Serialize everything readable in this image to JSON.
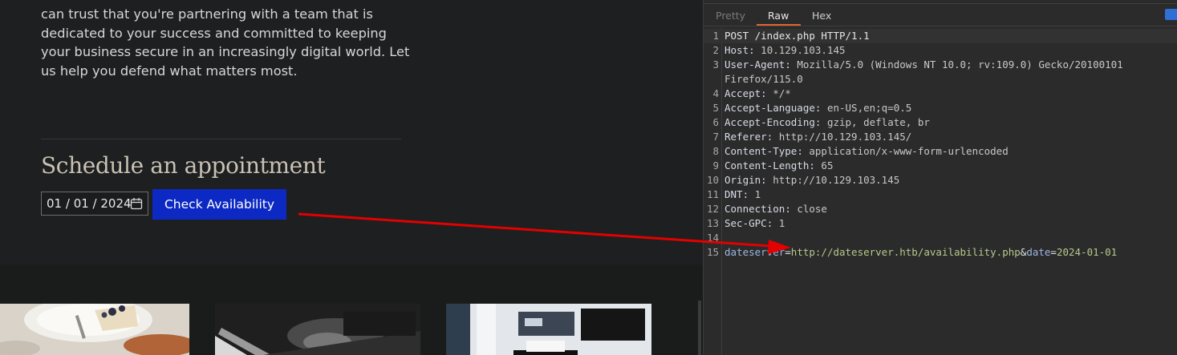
{
  "website": {
    "paragraph_lines": [
      "can trust that you're partnering with a team that is",
      "dedicated to your success and committed to keeping",
      "your business secure in an increasingly digital world. Let",
      "us help you defend what matters most."
    ],
    "schedule_title": "Schedule an appointment",
    "date": {
      "month": "01",
      "day": "01",
      "year": "2024"
    },
    "check_button": "Check Availability"
  },
  "burp": {
    "tabs": [
      "Pretty",
      "Raw",
      "Hex"
    ],
    "active_tab": "Raw",
    "request": {
      "request_line": "POST /index.php HTTP/1.1",
      "headers": [
        {
          "n": "Host",
          "v": "10.129.103.145"
        },
        {
          "n": "User-Agent",
          "v": "Mozilla/5.0 (Windows NT 10.0; rv:109.0) Gecko/20100101"
        },
        {
          "n": "",
          "v": "Firefox/115.0"
        },
        {
          "n": "Accept",
          "v": "*/*"
        },
        {
          "n": "Accept-Language",
          "v": "en-US,en;q=0.5"
        },
        {
          "n": "Accept-Encoding",
          "v": "gzip, deflate, br"
        },
        {
          "n": "Referer",
          "v": "http://10.129.103.145/"
        },
        {
          "n": "Content-Type",
          "v": "application/x-www-form-urlencoded"
        },
        {
          "n": "Content-Length",
          "v": "65"
        },
        {
          "n": "Origin",
          "v": "http://10.129.103.145"
        },
        {
          "n": "DNT",
          "v": "1"
        },
        {
          "n": "Connection",
          "v": "close"
        },
        {
          "n": "Sec-GPC",
          "v": "1"
        }
      ],
      "body": {
        "param1_key": "dateserver",
        "param1_value": "http://dateserver.htb/availability.php",
        "param2_key": "date",
        "param2_value": "2024-01-01"
      },
      "line_numbers": [
        "1",
        "2",
        "3",
        "",
        "4",
        "5",
        "6",
        "7",
        "8",
        "9",
        "10",
        "11",
        "12",
        "13",
        "14",
        "15"
      ]
    }
  },
  "colors": {
    "accent_button": "#0d29c4",
    "arrow": "#e30000",
    "tab_underline": "#e0652c"
  }
}
